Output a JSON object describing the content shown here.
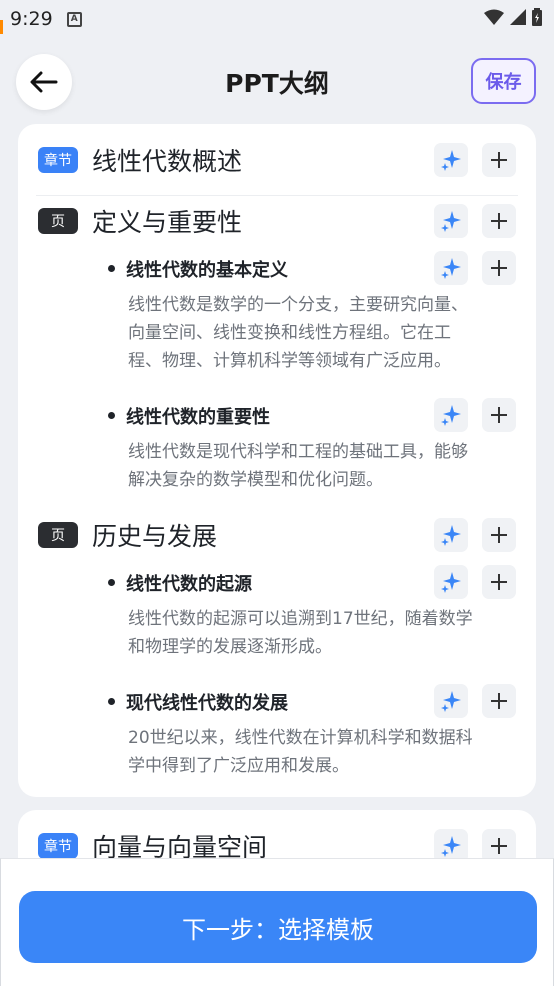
{
  "status": {
    "time": "9:29",
    "app_badge": "A"
  },
  "header": {
    "title": "PPT大纲",
    "save_label": "保存"
  },
  "outline": {
    "chapter1": {
      "badge": "章节",
      "title": "线性代数概述",
      "pages": [
        {
          "badge": "页",
          "title": "定义与重要性",
          "points": [
            {
              "title": "线性代数的基本定义",
              "desc_lines": [
                "线性代数是数学的一个分支，主要研究向量、",
                "向量空间、线性变换和线性方程组。它在工",
                "程、物理、计算机科学等领域有广泛应用。"
              ]
            },
            {
              "title": "线性代数的重要性",
              "desc_lines": [
                "线性代数是现代科学和工程的基础工具，能够",
                "解决复杂的数学模型和优化问题。"
              ]
            }
          ]
        },
        {
          "badge": "页",
          "title": "历史与发展",
          "points": [
            {
              "title": "线性代数的起源",
              "desc_lines": [
                "线性代数的起源可以追溯到17世纪，随着数学",
                "和物理学的发展逐渐形成。"
              ]
            },
            {
              "title": "现代线性代数的发展",
              "desc_lines": [
                "20世纪以来，线性代数在计算机科学和数据科",
                "学中得到了广泛应用和发展。"
              ]
            }
          ]
        }
      ]
    },
    "chapter2": {
      "badge": "章节",
      "title": "向量与向量空间"
    }
  },
  "footer": {
    "next_label": "下一步：选择模板"
  },
  "colors": {
    "accent": "#3a86f7",
    "save_border": "#7b6cf0",
    "chapter_chip": "#3a82f7",
    "page_chip": "#2b2d31"
  },
  "icons": {
    "back": "arrow-left-icon",
    "ai": "sparkle-icon",
    "add": "plus-icon"
  }
}
